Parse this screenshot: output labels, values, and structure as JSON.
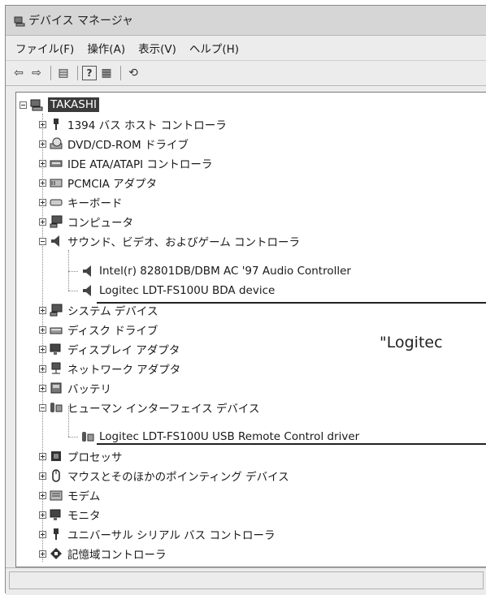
{
  "window": {
    "title": "デバイス マネージャ"
  },
  "menubar": {
    "items": [
      {
        "label": "ファイル(F)"
      },
      {
        "label": "操作(A)"
      },
      {
        "label": "表示(V)"
      },
      {
        "label": "ヘルプ(H)"
      }
    ]
  },
  "toolbar": {
    "buttons": [
      {
        "icon": "back-arrow-icon",
        "glyph": "⇦"
      },
      {
        "icon": "forward-arrow-icon",
        "glyph": "⇨"
      },
      {
        "icon": "properties-icon",
        "glyph": "▤"
      },
      {
        "icon": "help-icon",
        "glyph": "?"
      },
      {
        "icon": "show-hidden-icon",
        "glyph": "▦"
      },
      {
        "icon": "scan-hardware-icon",
        "glyph": "⟲"
      }
    ]
  },
  "tree": {
    "root": {
      "label": "TAKASHI",
      "icon": "computer-icon"
    },
    "items": [
      {
        "label": "1394 バス ホスト コントローラ",
        "icon": "plug-icon",
        "expanded": false
      },
      {
        "label": "DVD/CD-ROM ドライブ",
        "icon": "cdrom-icon",
        "expanded": false
      },
      {
        "label": "IDE ATA/ATAPI コントローラ",
        "icon": "ide-icon",
        "expanded": false
      },
      {
        "label": "PCMCIA アダプタ",
        "icon": "pcmcia-icon",
        "expanded": false
      },
      {
        "label": "キーボード",
        "icon": "keyboard-icon",
        "expanded": false
      },
      {
        "label": "コンピュータ",
        "icon": "computer-icon",
        "expanded": false
      },
      {
        "label": "サウンド、ビデオ、およびゲーム コントローラ",
        "icon": "speaker-icon",
        "expanded": true,
        "children": [
          {
            "label": "Intel(r) 82801DB/DBM AC '97 Audio Controller",
            "icon": "speaker-icon"
          },
          {
            "label": "Logitec LDT-FS100U BDA device",
            "icon": "speaker-icon"
          }
        ]
      },
      {
        "label": "システム デバイス",
        "icon": "computer-icon",
        "expanded": false
      },
      {
        "label": "ディスク ドライブ",
        "icon": "disk-icon",
        "expanded": false
      },
      {
        "label": "ディスプレイ アダプタ",
        "icon": "monitor-icon",
        "expanded": false
      },
      {
        "label": "ネットワーク アダプタ",
        "icon": "network-icon",
        "expanded": false
      },
      {
        "label": "バッテリ",
        "icon": "battery-icon",
        "expanded": false
      },
      {
        "label": "ヒューマン インターフェイス デバイス",
        "icon": "hid-icon",
        "expanded": true,
        "children": [
          {
            "label": "Logitec LDT-FS100U USB Remote Control driver",
            "icon": "hid-icon"
          }
        ]
      },
      {
        "label": "プロセッサ",
        "icon": "processor-icon",
        "expanded": false
      },
      {
        "label": "マウスとそのほかのポインティング デバイス",
        "icon": "mouse-icon",
        "expanded": false
      },
      {
        "label": "モデム",
        "icon": "modem-icon",
        "expanded": false
      },
      {
        "label": "モニタ",
        "icon": "monitor-icon",
        "expanded": false
      },
      {
        "label": "ユニバーサル シリアル バス コントローラ",
        "icon": "usb-icon",
        "expanded": false
      },
      {
        "label": "記憶域コントローラ",
        "icon": "storage-icon",
        "expanded": false
      }
    ]
  },
  "callout": {
    "text": "\"Logitec"
  }
}
